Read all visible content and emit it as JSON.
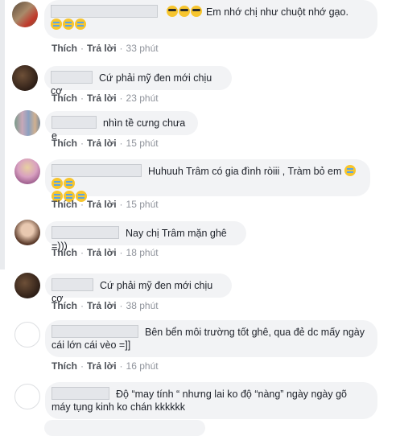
{
  "labels": {
    "like": "Thích",
    "reply": "Trả lời",
    "sep": "·"
  },
  "comments": [
    {
      "text": "Em nhớ chị như chuột nhớ gạo.",
      "time": "33 phút",
      "avatar": "avatar-photo",
      "emoji_before": "cool-face-emoji",
      "emoji_after": "crying-laughing-emoji",
      "colors": [
        "#8b6a4a",
        "#c0392b"
      ]
    },
    {
      "text": "Cứ phải mỹ đen mới chịu cơ",
      "time": "23 phút",
      "avatar": "avatar-photo",
      "colors": [
        "#3a2a20",
        "#6e5038"
      ]
    },
    {
      "text": "nhìn tề cưng chưa e",
      "time": "15 phút",
      "avatar": "avatar-photo",
      "colors": [
        "#7a9a8a",
        "#c8a8b8"
      ]
    },
    {
      "text": "Huhuuh Trâm có gia đình ròiii , Tràm bỏ em",
      "time": "15 phút",
      "avatar": "avatar-photo",
      "emoji_after": "crying-emoji",
      "colors": [
        "#d8a0c0",
        "#e8d0a0"
      ]
    },
    {
      "text": "Nay chị Trâm mặn ghê =)))",
      "time": "18 phút",
      "avatar": "avatar-photo",
      "colors": [
        "#5a3a2a",
        "#e8c8b0"
      ]
    },
    {
      "text": "Cứ phải mỹ đen mới chịu cơ",
      "time": "38 phút",
      "avatar": "avatar-photo",
      "colors": [
        "#3a2a20",
        "#6e5038"
      ]
    },
    {
      "text": "Bên bển môi trường tốt ghê, qua đẻ dc mấy ngày cái lớn cái vèo =]]",
      "time": "16 phút",
      "avatar": "avatar-empty"
    },
    {
      "text": "Độ “may tính “ nhưng lai ko độ “nàng” ngày ngày gõ máy tụng kinh ko chán kkkkkk",
      "avatar": "avatar-empty"
    }
  ]
}
